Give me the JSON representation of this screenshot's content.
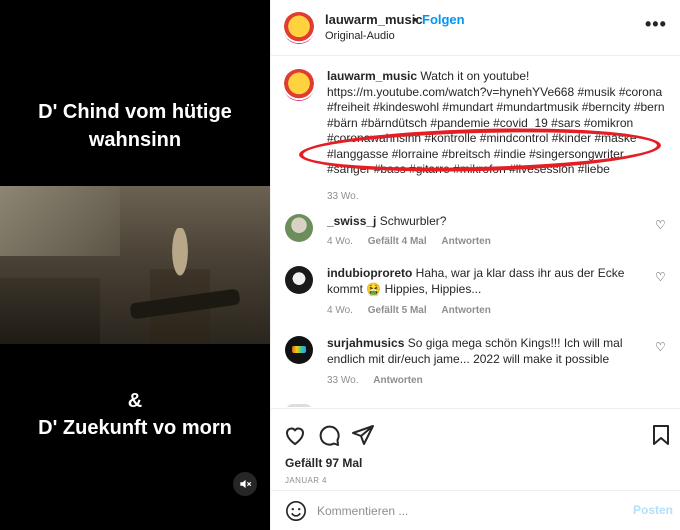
{
  "video": {
    "line1": "D' Chind vom hütige",
    "line2": "wahnsinn",
    "amp": "&",
    "line3": "D' Zuekunft vo morn",
    "mute_icon": "muted-speaker-icon"
  },
  "header": {
    "username": "lauwarm_music",
    "separator": "•",
    "follow_label": "Folgen",
    "audio_label": "Original-Audio",
    "more_label": "•••"
  },
  "caption": {
    "username": "lauwarm_music",
    "text": "Watch it on youtube! https://m.youtube.com/watch?v=hynehYVe668 #musik #corona #freiheit #kindeswohl #mundart #mundartmusik #berncity #bern #bärn #bärndütsch #pandemie #covid_19 #sars #omikron #coronawahnsinn #kontrolle #mindcontrol #kinder #maske #langgasse #lorraine #breitsch #indie #singersongwriter #sänger #bass #gitarre #mikrofon #livesession #liebe",
    "time": "33 Wo."
  },
  "comments": [
    {
      "username": "_swiss_j",
      "text": "Schwurbler?",
      "time": "4 Wo.",
      "likes": "Gefällt 4 Mal",
      "reply": "Antworten"
    },
    {
      "username": "indubioproreto",
      "text": "Haha, war ja klar dass ihr aus der Ecke kommt 🤮 Hippies, Hippies...",
      "time": "4 Wo.",
      "likes": "Gefällt 5 Mal",
      "reply": "Antworten"
    },
    {
      "username": "surjahmusics",
      "text": "So giga mega schön Kings!!! Ich will mal endlich mit dir/euch jame... 2022 will make it possible",
      "time": "33 Wo.",
      "reply": "Antworten"
    }
  ],
  "actions": {
    "likes": "Gefällt 97 Mal",
    "date": "JANUAR 4"
  },
  "composer": {
    "placeholder": "Kommentieren ...",
    "post_label": "Posten"
  },
  "colors": {
    "accent": "#0095f6",
    "annotation": "#e31e24",
    "post_disabled": "#b2dffc"
  }
}
